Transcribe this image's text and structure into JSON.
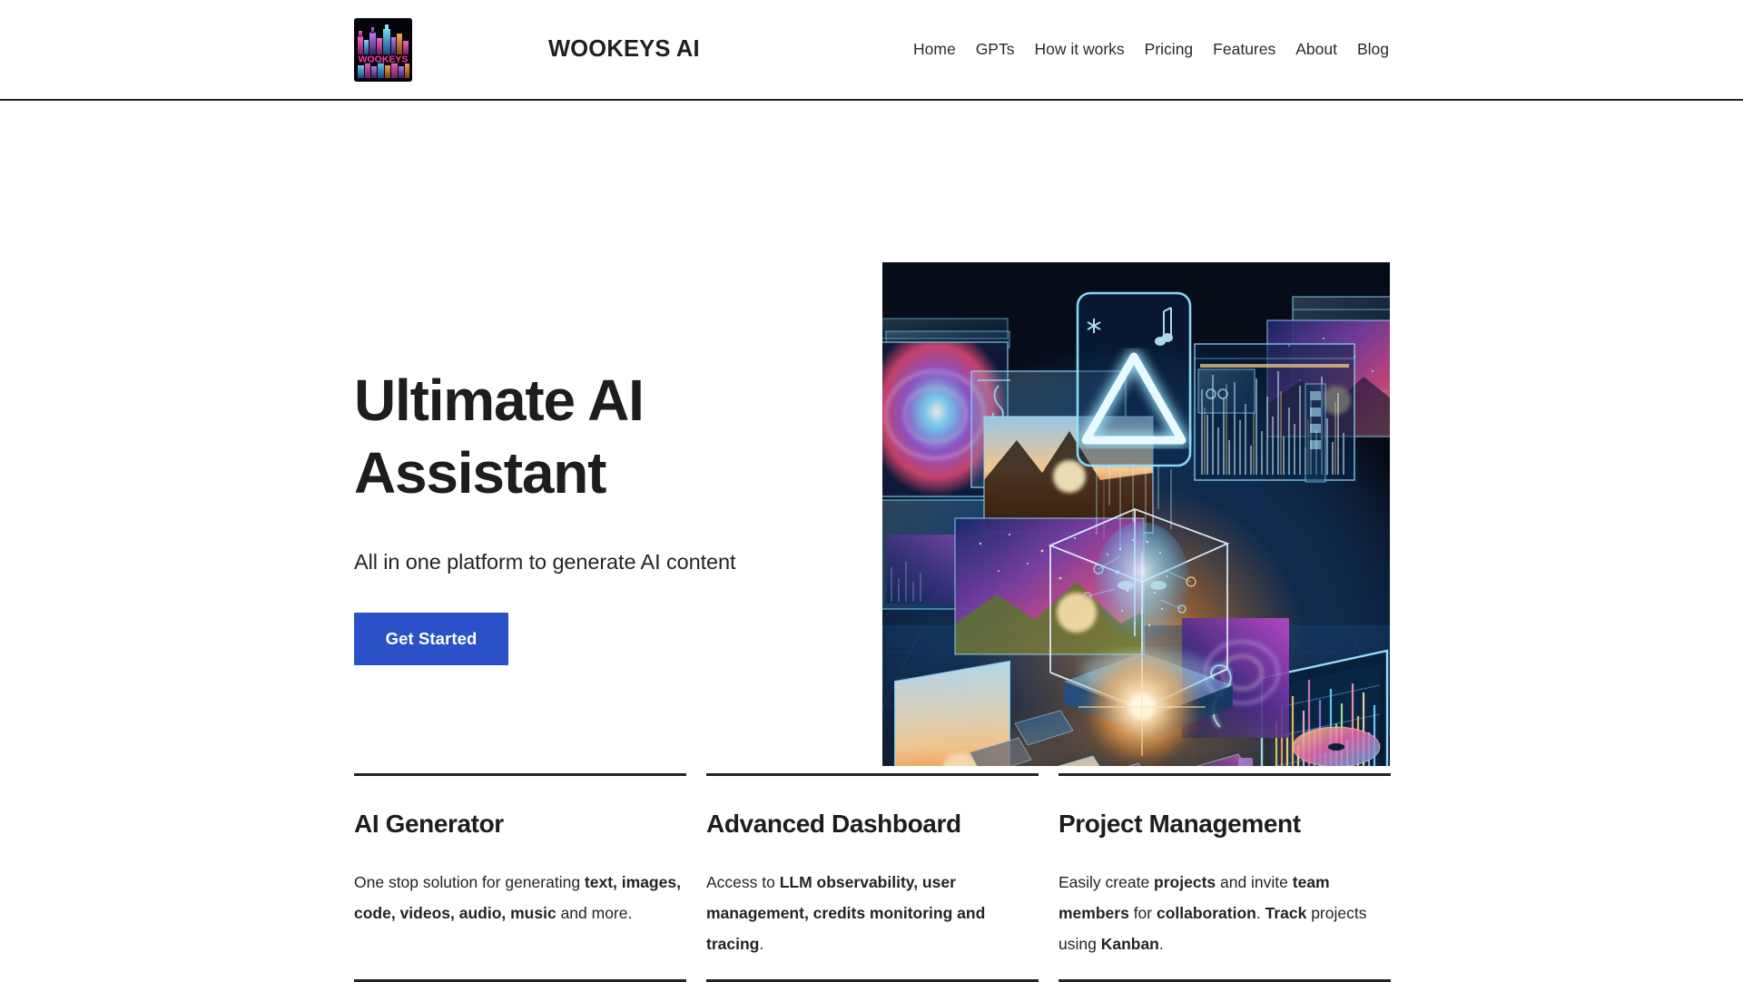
{
  "header": {
    "brand_title": "WOOKEYS AI",
    "logo_alt": "WOOKEYS",
    "logo_word": "WOOKEYS",
    "nav": [
      {
        "label": "Home",
        "name": "nav-link-home"
      },
      {
        "label": "GPTs",
        "name": "nav-link-gpts"
      },
      {
        "label": "How it works",
        "name": "nav-link-how-it-works"
      },
      {
        "label": "Pricing",
        "name": "nav-link-pricing"
      },
      {
        "label": "Features",
        "name": "nav-link-features"
      },
      {
        "label": "About",
        "name": "nav-link-about"
      },
      {
        "label": "Blog",
        "name": "nav-link-blog"
      }
    ]
  },
  "hero": {
    "title": "Ultimate AI Assistant",
    "subtitle": "All in one platform to generate AI content",
    "cta_label": "Get Started",
    "image_alt": "Futuristic AI workspace with floating holographic screens, neon triangle logo, particle head and colorful data charts"
  },
  "features": [
    {
      "title": "AI Generator",
      "body_parts": [
        {
          "text": "One stop solution for generating ",
          "bold": false
        },
        {
          "text": "text, images, code, videos, audio, music",
          "bold": true
        },
        {
          "text": " and more.",
          "bold": false
        }
      ]
    },
    {
      "title": "Advanced Dashboard",
      "body_parts": [
        {
          "text": "Access to ",
          "bold": false
        },
        {
          "text": "LLM observability, user management, credits monitoring and tracing",
          "bold": true
        },
        {
          "text": ".",
          "bold": false
        }
      ]
    },
    {
      "title": "Project Management",
      "body_parts": [
        {
          "text": "Easily create ",
          "bold": false
        },
        {
          "text": "projects",
          "bold": true
        },
        {
          "text": " and invite ",
          "bold": false
        },
        {
          "text": "team members",
          "bold": true
        },
        {
          "text": " for ",
          "bold": false
        },
        {
          "text": "collaboration",
          "bold": true
        },
        {
          "text": ". ",
          "bold": false
        },
        {
          "text": "Track",
          "bold": true
        },
        {
          "text": " projects using ",
          "bold": false
        },
        {
          "text": "Kanban",
          "bold": true
        },
        {
          "text": ".",
          "bold": false
        }
      ]
    }
  ],
  "colors": {
    "accent_blue": "#2a51c8",
    "text_primary": "#1d1d1d",
    "rule": "#232323",
    "page_bg": "#ffffff",
    "logo_neon_pink": "#ff3ea5",
    "art_bg_deep": "#060c18",
    "art_cyan": "#7fd8ff"
  }
}
